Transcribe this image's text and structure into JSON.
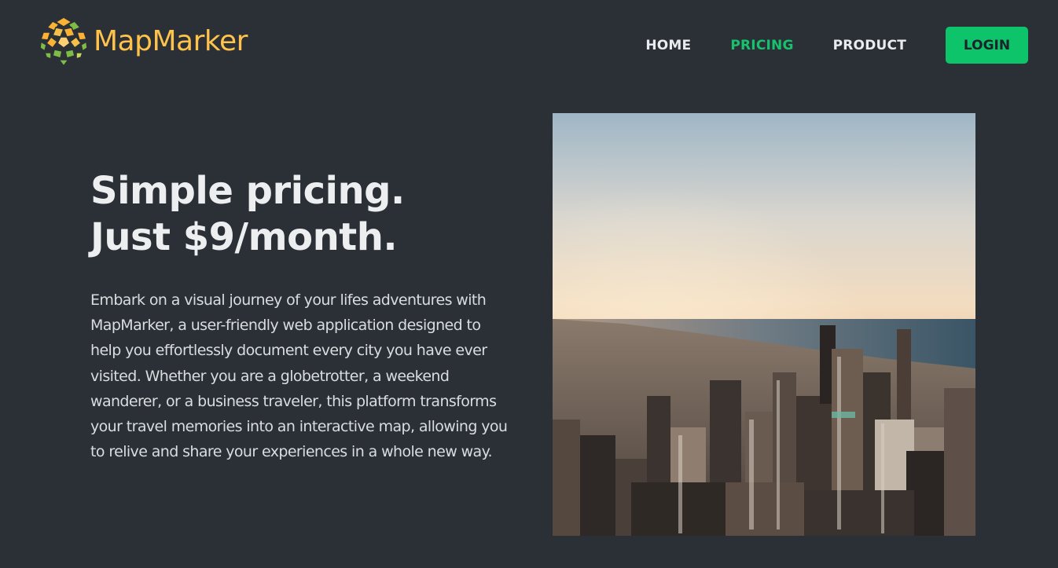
{
  "brand": {
    "name": "MapMarker",
    "logo_icon": "geo-mosaic-globe-icon",
    "logo_colors": [
      "#f9b233",
      "#7dbd45",
      "#c8d65a"
    ]
  },
  "nav": {
    "links": [
      {
        "label": "HOME",
        "active": false
      },
      {
        "label": "PRICING",
        "active": true
      },
      {
        "label": "PRODUCT",
        "active": false
      }
    ],
    "login_label": "LOGIN"
  },
  "hero": {
    "title_line1": "Simple pricing.",
    "title_line2": "Just $9/month.",
    "description": "Embark on a visual journey of your lifes adventures with MapMarker, a user-friendly web application designed to help you effortlessly document every city you have ever visited. Whether you are a globetrotter, a weekend wanderer, or a business traveler, this platform transforms your travel memories into an interactive map, allowing you to relive and share your experiences in a whole new way.",
    "image": "city-skyline-aerial-photo"
  },
  "colors": {
    "background": "#2b3036",
    "accent": "#0ec46b",
    "brand": "#ffc24a",
    "text": "#e9ecee"
  }
}
